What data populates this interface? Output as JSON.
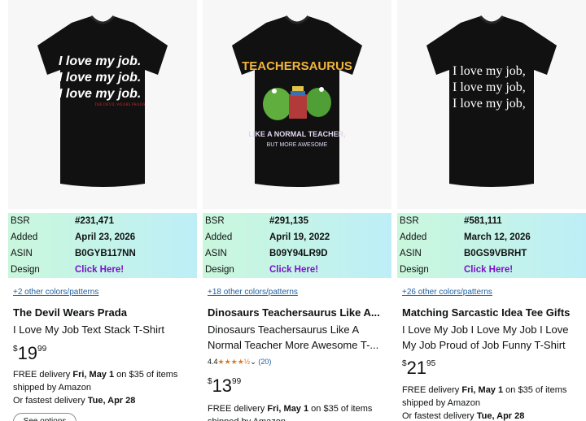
{
  "products": [
    {
      "shirt_lines": [
        "I love my job.",
        "I love my job.",
        "I love my job."
      ],
      "logo_text": "THE DEVIL WEARS PRADA",
      "bsr_label": "BSR",
      "bsr": "#231,471",
      "added_label": "Added",
      "added": "April 23, 2026",
      "asin_label": "ASIN",
      "asin": "B0GYB117NN",
      "design_label": "Design",
      "design": "Click Here!",
      "colors": "+2 other colors/patterns",
      "brand": "The Devil Wears Prada",
      "title": "I Love My Job Text Stack T-Shirt",
      "price_symbol": "$",
      "price_whole": "19",
      "price_cents": "99",
      "delivery_prefix": "FREE delivery ",
      "delivery_date": "Fri, May 1",
      "delivery_suffix": " on $35 of items shipped by Amazon",
      "fastest_prefix": "Or fastest delivery ",
      "fastest_date": "Tue, Apr 28",
      "options_button": "See options"
    },
    {
      "shirt_title": "TEACHERSAURUS",
      "shirt_line1": "LIKE A NORMAL TEACHER,",
      "shirt_line2": "BUT MORE AWESOME",
      "bsr_label": "BSR",
      "bsr": "#291,135",
      "added_label": "Added",
      "added": "April 19, 2022",
      "asin_label": "ASIN",
      "asin": "B09Y94LR9D",
      "design_label": "Design",
      "design": "Click Here!",
      "colors": "+18 other colors/patterns",
      "brand": "Dinosaurs Teachersaurus Like A...",
      "title": "Dinosaurs Teachersaurus Like A Normal Teacher More Awesome T-...",
      "rating_value": "4.4",
      "stars": "★★★★½",
      "rating_count": "(20)",
      "price_symbol": "$",
      "price_whole": "13",
      "price_cents": "99",
      "delivery_prefix": "FREE delivery ",
      "delivery_date": "Fri, May 1",
      "delivery_suffix": " on $35 of items shipped by Amazon"
    },
    {
      "shirt_lines": [
        "I love my job,",
        "I love my job,",
        "I love my job,"
      ],
      "bsr_label": "BSR",
      "bsr": "#581,111",
      "added_label": "Added",
      "added": "March 12, 2026",
      "asin_label": "ASIN",
      "asin": "B0GS9VBRHT",
      "design_label": "Design",
      "design": "Click Here!",
      "colors": "+26 other colors/patterns",
      "brand": "Matching Sarcastic Idea Tee Gifts",
      "title": "I Love My Job I Love My Job I Love My Job Proud of Job Funny T-Shirt",
      "price_symbol": "$",
      "price_whole": "21",
      "price_cents": "95",
      "delivery_prefix": "FREE delivery ",
      "delivery_date": "Fri, May 1",
      "delivery_suffix": " on $35 of items shipped by Amazon",
      "fastest_prefix": "Or fastest delivery ",
      "fastest_date": "Tue, Apr 28"
    }
  ],
  "colors": {
    "shirt": "#111111",
    "link": "#2162a1",
    "design_link": "#7a12c9",
    "star": "#de7921",
    "info_bg_start": "#c9f7dc",
    "info_bg_end": "#bdeef7"
  }
}
